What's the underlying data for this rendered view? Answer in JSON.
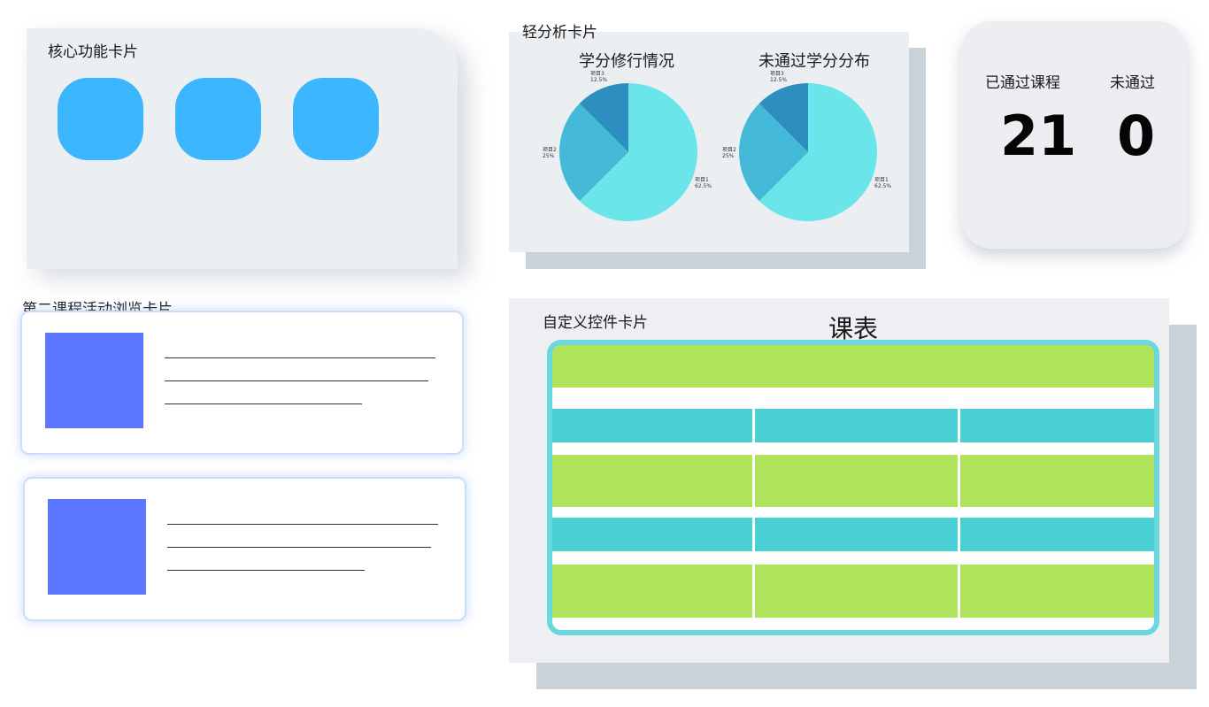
{
  "core": {
    "title": "核心功能卡片"
  },
  "analysis": {
    "title": "轻分析卡片",
    "charts": [
      {
        "title": "学分修行情况"
      },
      {
        "title": "未通过学分分布"
      }
    ]
  },
  "chart_data": [
    {
      "type": "pie",
      "title": "学分修行情况",
      "labels": [
        "项目1",
        "项目2",
        "项目3"
      ],
      "values": [
        62.5,
        25,
        12.5
      ],
      "value_labels": [
        "62.5%",
        "25%",
        "12.5%"
      ],
      "colors": [
        "#6ae6ea",
        "#44b9d8",
        "#2d8fbf"
      ]
    },
    {
      "type": "pie",
      "title": "未通过学分分布",
      "labels": [
        "项目1",
        "项目2",
        "项目3"
      ],
      "values": [
        62.5,
        25,
        12.5
      ],
      "value_labels": [
        "62.5%",
        "25%",
        "12.5%"
      ],
      "colors": [
        "#6ae6ea",
        "#44b9d8",
        "#2d8fbf"
      ]
    }
  ],
  "stats": {
    "passed_label": "已通过课程",
    "failed_label": "未通过",
    "passed_value": "21",
    "failed_value": "0"
  },
  "activity": {
    "title": "第二课程活动浏览卡片"
  },
  "custom": {
    "title": "自定义控件卡片",
    "schedule_title": "课表"
  },
  "colors": {
    "accent_blue": "#3bb6ff",
    "thumb_blue": "#5c76ff",
    "schedule_green": "#afe35c",
    "schedule_teal": "#49cfd4"
  }
}
